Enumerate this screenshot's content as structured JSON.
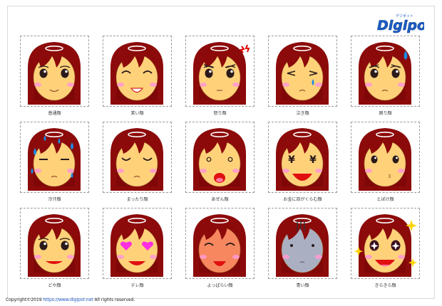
{
  "logo": {
    "text": "Digipot",
    "subtext": "デジポット"
  },
  "faces": [
    {
      "label": "普通顔",
      "type": "normal",
      "skin": "#ffd27a"
    },
    {
      "label": "笑い顔",
      "type": "laugh",
      "skin": "#ffd27a"
    },
    {
      "label": "怒り顔",
      "type": "angry",
      "skin": "#ffd27a"
    },
    {
      "label": "泣き顔",
      "type": "cry",
      "skin": "#ffd27a"
    },
    {
      "label": "困り顔",
      "type": "trouble",
      "skin": "#ffd27a"
    },
    {
      "label": "冷汗顔",
      "type": "sweat",
      "skin": "#ffd27a"
    },
    {
      "label": "まったり顔",
      "type": "relax",
      "skin": "#ffd27a"
    },
    {
      "label": "あぜん顔",
      "type": "dumb",
      "skin": "#ffd27a"
    },
    {
      "label": "お金に目がくらむ顔",
      "type": "money",
      "skin": "#ffd27a"
    },
    {
      "label": "とぼけ顔",
      "type": "feign",
      "skin": "#ffd27a"
    },
    {
      "label": "どや顔",
      "type": "smug",
      "skin": "#ffd27a"
    },
    {
      "label": "デレ顔",
      "type": "love",
      "skin": "#ffd27a"
    },
    {
      "label": "よっぱらい顔",
      "type": "drunk",
      "skin": "#f7875f"
    },
    {
      "label": "青い顔",
      "type": "pale",
      "skin": "#aab0c2"
    },
    {
      "label": "きらきら顔",
      "type": "sparkle",
      "skin": "#ffd27a"
    }
  ],
  "footer": {
    "prefix": "Copyright©2019 ",
    "url": "https://www.digipot.net",
    "suffix": " All rights reserved."
  },
  "colors": {
    "hair": "#8c0a0a",
    "hairDark": "#5a0000",
    "cheek": "#ff9ad0",
    "mouth": "#e01010"
  }
}
